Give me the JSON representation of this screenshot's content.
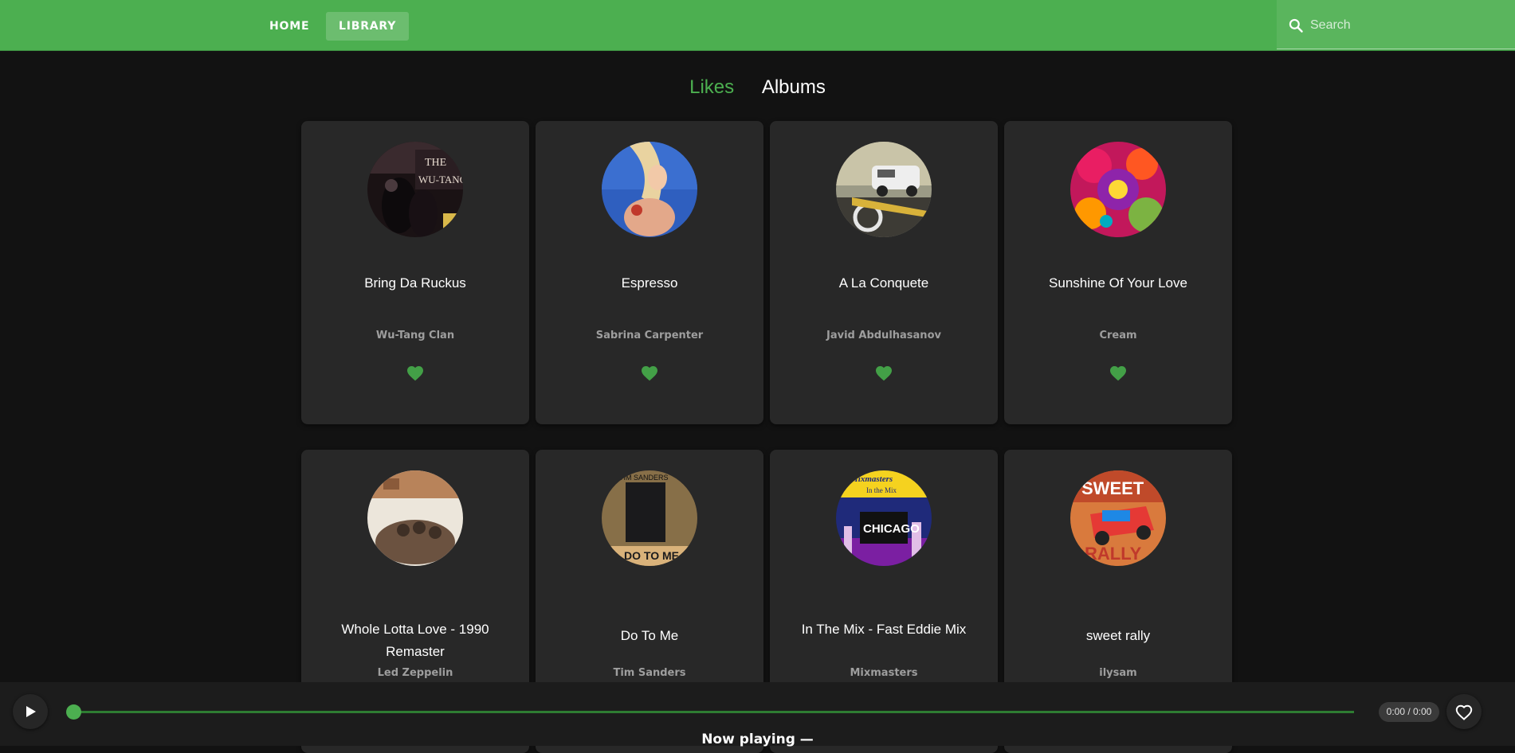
{
  "nav": {
    "home_label": "HOME",
    "library_label": "LIBRARY",
    "active": "LIBRARY"
  },
  "search": {
    "placeholder": "Search",
    "value": "",
    "icon": "search-icon"
  },
  "tabs": [
    {
      "label": "Likes",
      "active": true
    },
    {
      "label": "Albums",
      "active": false
    }
  ],
  "tracks": [
    {
      "title": "Bring Da Ruckus",
      "artist": "Wu-Tang Clan",
      "liked": true
    },
    {
      "title": "Espresso",
      "artist": "Sabrina Carpenter",
      "liked": true
    },
    {
      "title": "A La Conquete",
      "artist": "Javid Abdulhasanov",
      "liked": true
    },
    {
      "title": "Sunshine Of Your Love",
      "artist": "Cream",
      "liked": true
    },
    {
      "title": "Whole Lotta Love - 1990 Remaster",
      "artist": "Led Zeppelin",
      "liked": true
    },
    {
      "title": "Do To Me",
      "artist": "Tim Sanders",
      "liked": true
    },
    {
      "title": "In The Mix - Fast Eddie Mix",
      "artist": "Mixmasters",
      "liked": true
    },
    {
      "title": "sweet rally",
      "artist": "ilysam",
      "liked": true
    }
  ],
  "player": {
    "time": "0:00 / 0:00",
    "progress": 0,
    "now_playing": "Now playing —",
    "play_icon": "play-icon",
    "like_icon": "heart-outline-icon"
  },
  "colors": {
    "accent": "#4caf50",
    "background": "#121212",
    "card": "#282828",
    "heart": "#43a047"
  }
}
